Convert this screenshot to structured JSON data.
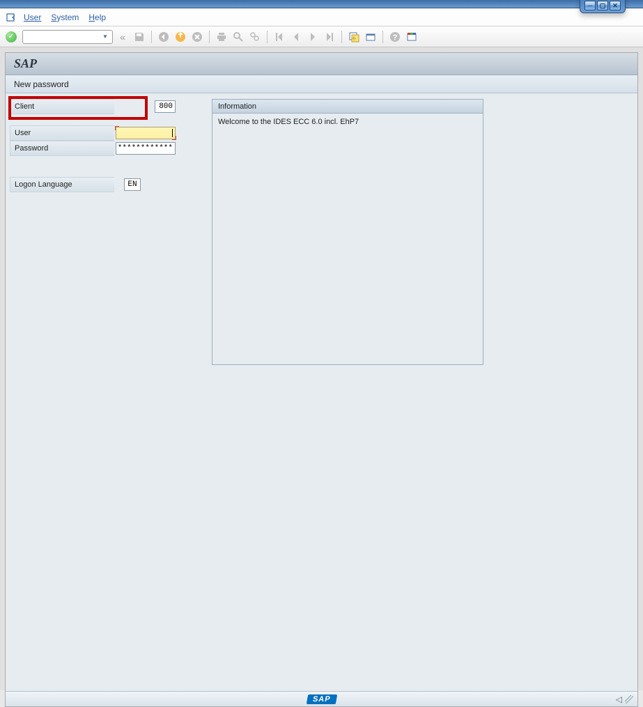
{
  "window": {
    "minimize": "─",
    "maximize": "▢",
    "close": "✕"
  },
  "menubar": {
    "user": "User",
    "system": "System",
    "help": "Help"
  },
  "toolbar": {
    "double_left": "«"
  },
  "app": {
    "title": "SAP",
    "subtitle": "New password"
  },
  "form": {
    "client_label": "Client",
    "client_value": "800",
    "user_label": "User",
    "user_value": "",
    "password_label": "Password",
    "password_value": "************",
    "language_label": "Logon Language",
    "language_value": "EN"
  },
  "info": {
    "header": "Information",
    "body": "Welcome to the IDES ECC 6.0 incl. EhP7"
  },
  "footer": {
    "logo": "SAP",
    "collapse": "◁"
  }
}
